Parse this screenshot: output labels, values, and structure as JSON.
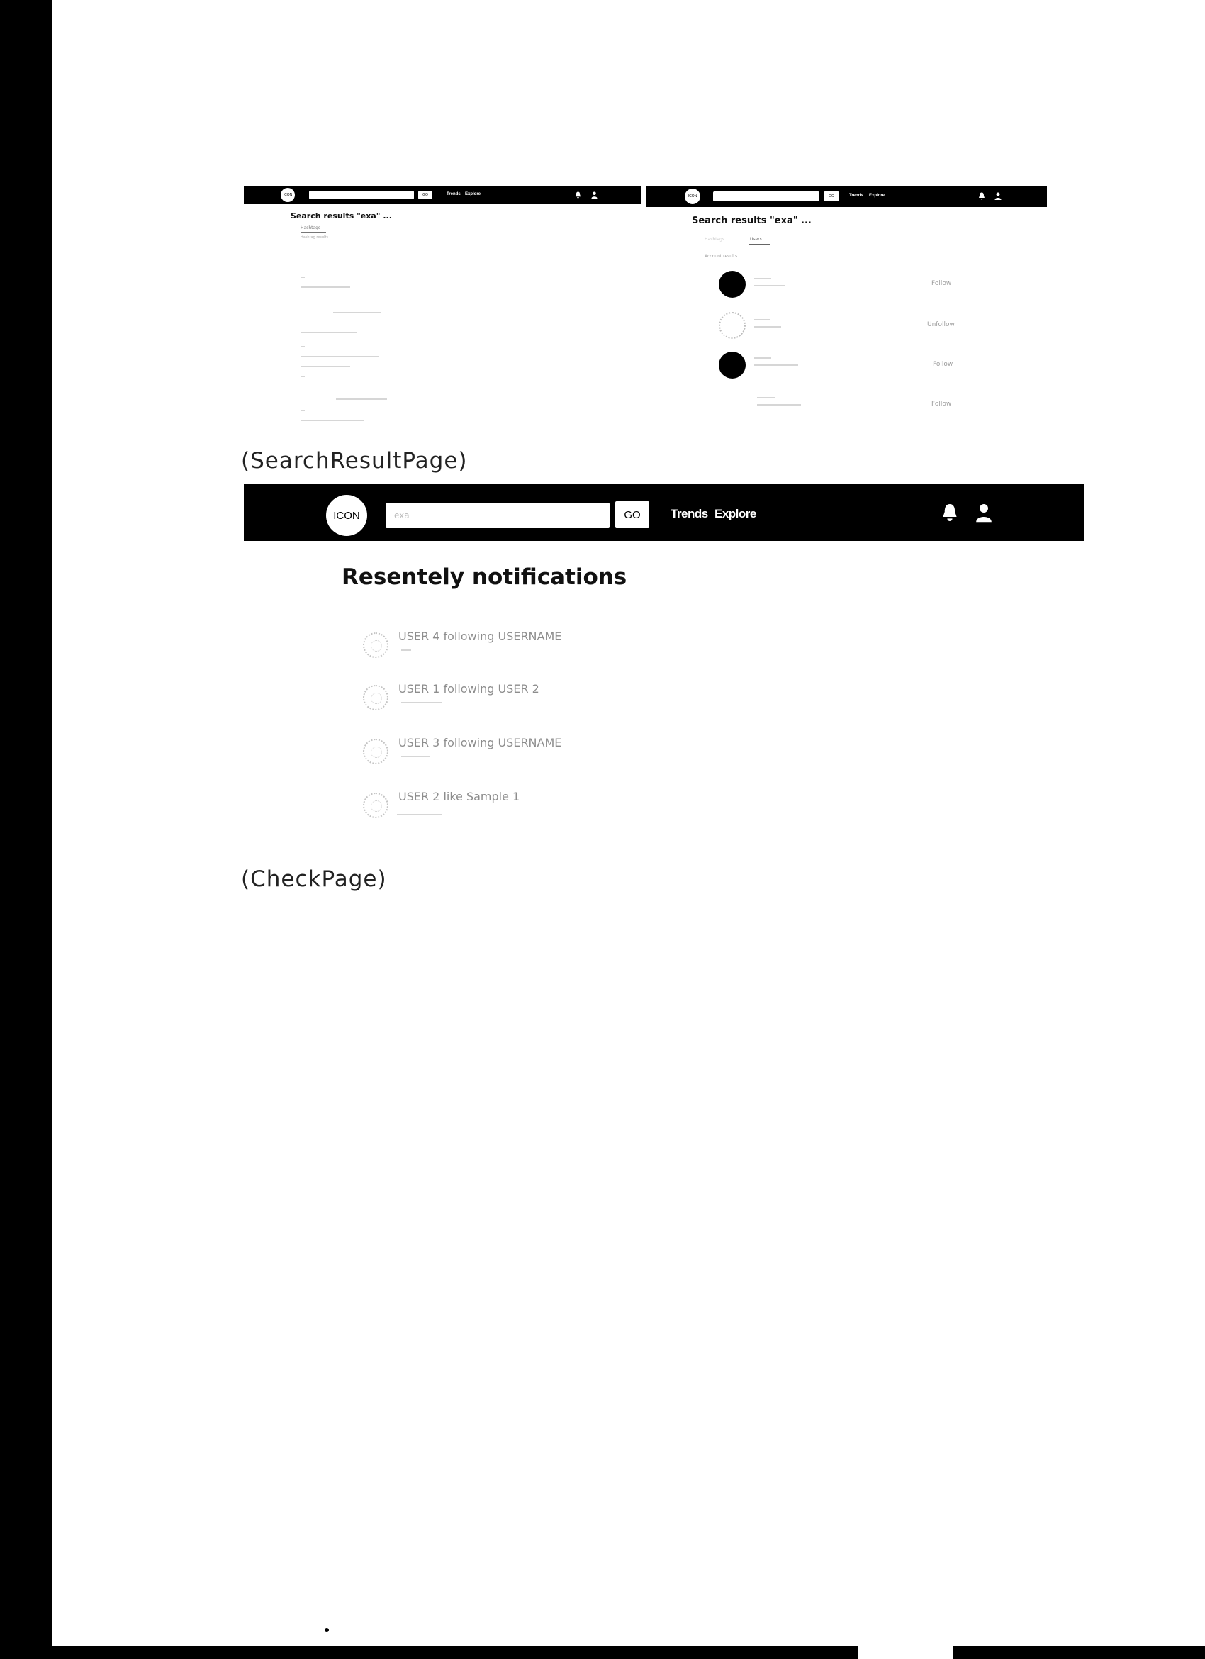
{
  "thumb_left": {
    "nav": {
      "logo": "ICON",
      "go": "GO",
      "trends": "Trends",
      "explore": "Explore"
    },
    "title": "Search results \"exa\" ...",
    "tab_label": "Hashtags",
    "hint": "Hashtag results"
  },
  "thumb_right": {
    "nav": {
      "logo": "ICON",
      "go": "GO",
      "trends": "Trends",
      "explore": "Explore"
    },
    "title": "Search results \"exa\" ...",
    "tabs": [
      "Hashtags",
      "Users"
    ],
    "hint": "Account results",
    "users": [
      {
        "follow": "Follow"
      },
      {
        "follow": "Unfollow"
      },
      {
        "follow": "Follow"
      },
      {
        "follow": "Follow"
      }
    ]
  },
  "caption_search": "(SearchResultPage)",
  "main": {
    "nav": {
      "logo": "ICON",
      "search_value": "exa",
      "go": "GO",
      "trends": "Trends",
      "explore": "Explore"
    },
    "title": "Resentely notifications",
    "notifications": [
      {
        "text": "USER 4 following USERNAME"
      },
      {
        "text": "USER 1 following USER 2"
      },
      {
        "text": "USER 3 following USERNAME"
      },
      {
        "text": "USER 2 like Sample 1"
      }
    ]
  },
  "caption_check": "(CheckPage)"
}
